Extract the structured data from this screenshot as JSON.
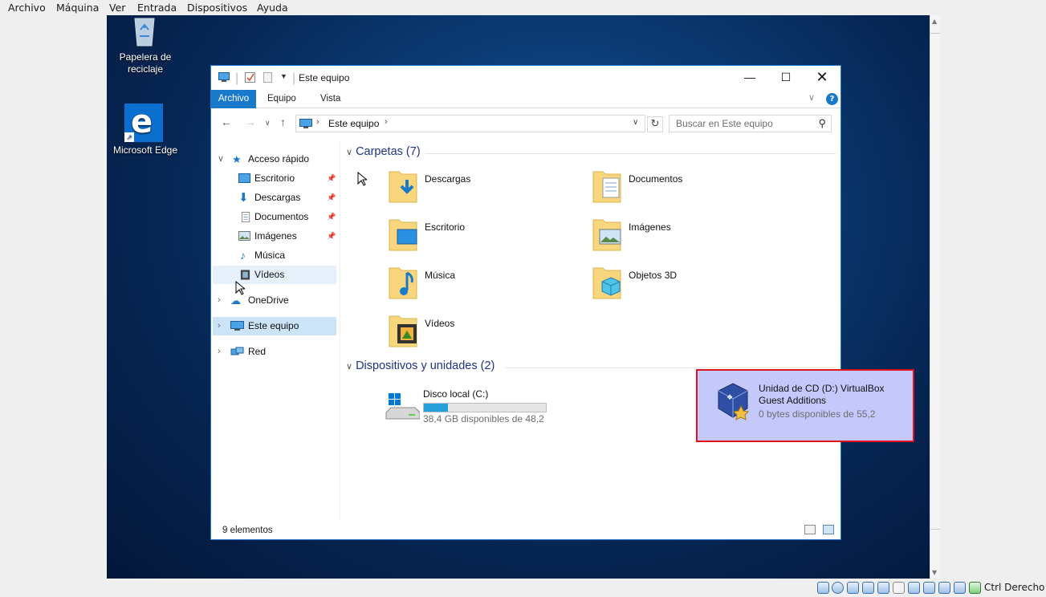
{
  "host_menu": [
    "Archivo",
    "Máquina",
    "Ver",
    "Entrada",
    "Dispositivos",
    "Ayuda"
  ],
  "host_status": {
    "host_key": "Ctrl Derecho"
  },
  "desktop": {
    "recycle_bin": "Papelera de\nreciclaje",
    "edge": "Microsoft Edge"
  },
  "explorer": {
    "title": "Este equipo",
    "ribbon_tabs": [
      "Archivo",
      "Equipo",
      "Vista"
    ],
    "help": "?",
    "address": "Este equipo",
    "search_placeholder": "Buscar en Este equipo",
    "nav": {
      "quick_access": "Acceso rápido",
      "quick_items": [
        "Escritorio",
        "Descargas",
        "Documentos",
        "Imágenes",
        "Música",
        "Vídeos"
      ],
      "onedrive": "OneDrive",
      "this_pc": "Este equipo",
      "network": "Red"
    },
    "folders_group": "Carpetas (7)",
    "folders": [
      "Descargas",
      "Documentos",
      "Escritorio",
      "Imágenes",
      "Música",
      "Objetos 3D",
      "Vídeos"
    ],
    "devices_group": "Dispositivos y unidades (2)",
    "drive_c": {
      "name": "Disco local (C:)",
      "free": "38,4 GB disponibles de 48,2",
      "used_fraction": 0.2
    },
    "drive_d": {
      "name_line1": "Unidad de CD (D:) VirtualBox",
      "name_line2": "Guest Additions",
      "free": "0 bytes disponibles de 55,2"
    },
    "status": "9 elementos"
  }
}
